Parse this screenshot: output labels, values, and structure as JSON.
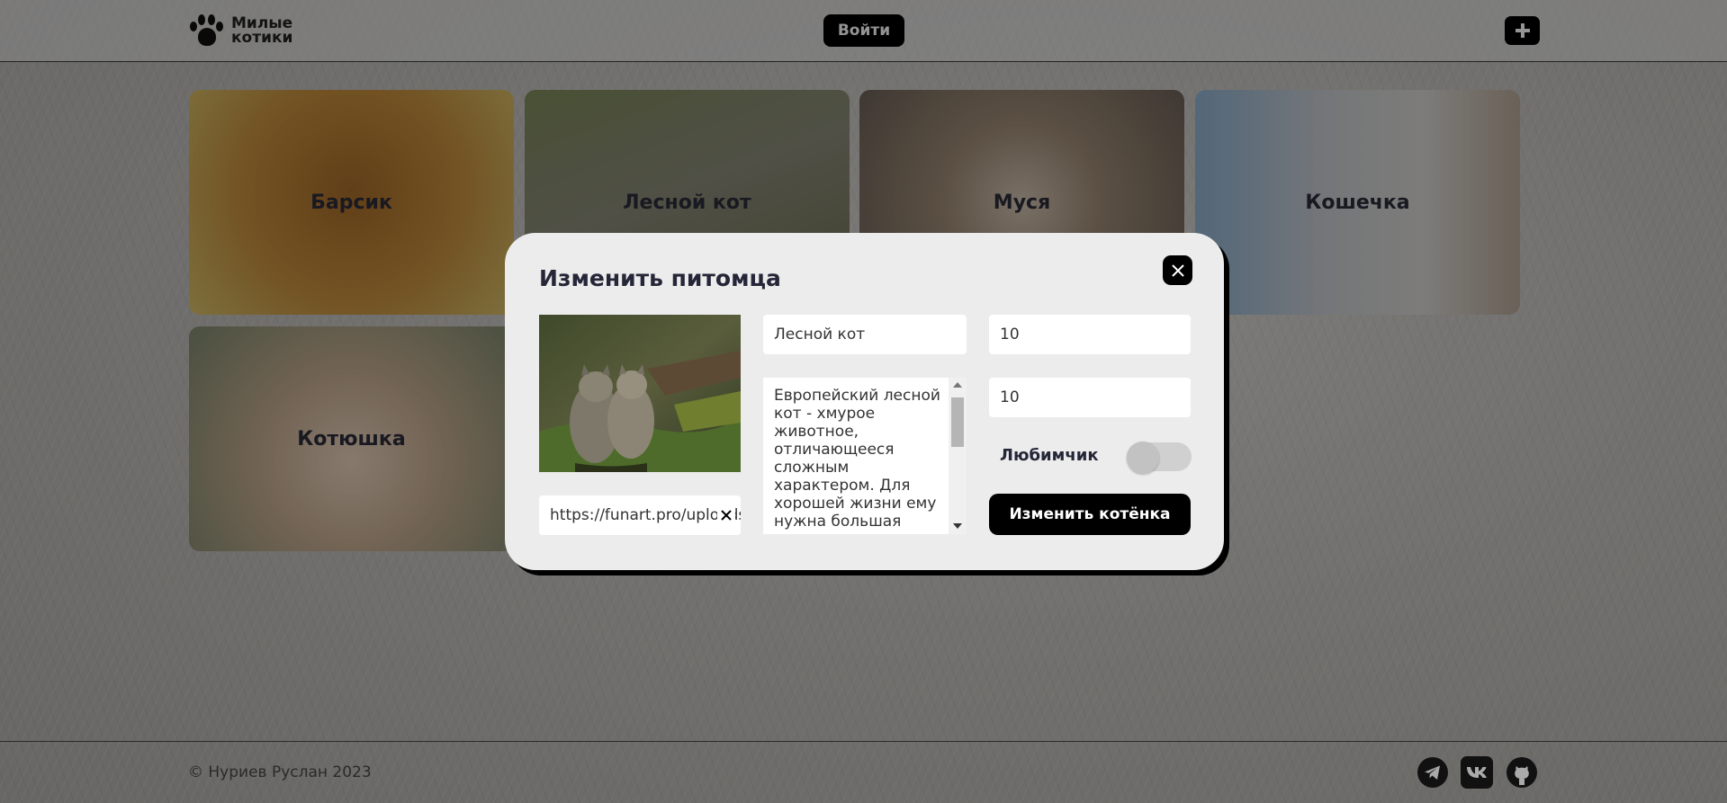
{
  "header": {
    "logo_line1": "Милые",
    "logo_line2": "котики",
    "login_label": "Войти"
  },
  "cards": [
    {
      "name": "Барсик",
      "color": "#b87a2f"
    },
    {
      "name": "Лесной кот",
      "color": "#7e8463"
    },
    {
      "name": "Муся",
      "color": "#8f8375"
    },
    {
      "name": "Кошечка",
      "color": "#a2b8c8"
    },
    {
      "name": "Котюшка",
      "color": "#c7b09b"
    }
  ],
  "modal": {
    "title": "Изменить питомца",
    "image_url": "https://funart.pro/uploads",
    "name": "Лесной кот",
    "description": "Европейский лесной кот - хмурое животное, отличающееся сложным характером. Для хорошей жизни ему нужна большая",
    "age": "10",
    "rate": "10",
    "favorite_label": "Любимчик",
    "favorite": false,
    "submit_label": "Изменить котёнка"
  },
  "footer": {
    "copyright": "© Нуриев Руслан 2023",
    "social": [
      "telegram-icon",
      "vk-icon",
      "github-icon"
    ]
  }
}
